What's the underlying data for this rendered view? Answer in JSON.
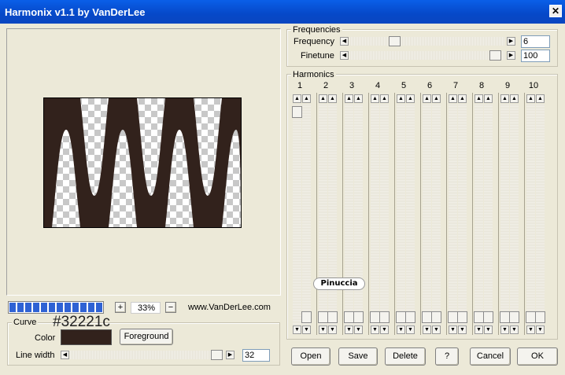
{
  "window": {
    "title": "Harmonix v1.1 by VanDerLee",
    "close_glyph": "✕"
  },
  "preview": {
    "progress_fraction": 1.0,
    "zoom": "33%",
    "zoom_in": "+",
    "zoom_out": "−",
    "website": "www.VanDerLee.com"
  },
  "curve": {
    "group_label": "Curve",
    "color_label": "Color",
    "color_hex": "#32221c",
    "color_value": "#32221c",
    "foreground_button": "Foreground",
    "line_width_label": "Line width",
    "line_width_value": "32"
  },
  "frequencies": {
    "group_label": "Frequencies",
    "frequency_label": "Frequency",
    "frequency_value": "6",
    "finetune_label": "Finetune",
    "finetune_value": "100"
  },
  "harmonics": {
    "group_label": "Harmonics",
    "columns": [
      "1",
      "2",
      "3",
      "4",
      "5",
      "6",
      "7",
      "8",
      "9",
      "10"
    ]
  },
  "watermark": "Pinuccia",
  "buttons": {
    "open": "Open",
    "save": "Save",
    "delete": "Delete",
    "help": "?",
    "cancel": "Cancel",
    "ok": "OK"
  }
}
